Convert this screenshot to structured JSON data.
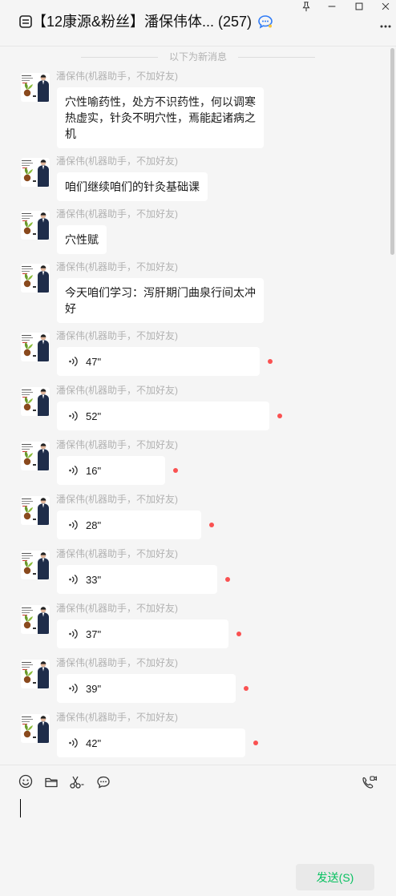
{
  "window": {
    "title": "【12康源&粉丝】潘保伟体...",
    "member_count": "(257)",
    "title_icon": "chat-list-icon",
    "badge_icon": "blue-chat-icon",
    "controls": [
      "pin-icon",
      "minimize-icon",
      "maximize-icon",
      "close-icon"
    ],
    "more_icon": "more-icon"
  },
  "chat": {
    "new_messages_divider": "以下为新消息",
    "messages": [
      {
        "sender": "潘保伟(机器助手，不加好友)",
        "type": "text",
        "lines": [
          "穴性喻药性，处方不识药性，何以调寒",
          "热虚实，针灸不明穴性，焉能起诸病之",
          "机"
        ]
      },
      {
        "sender": "潘保伟(机器助手，不加好友)",
        "type": "text",
        "lines": [
          "咱们继续咱们的针灸基础课"
        ]
      },
      {
        "sender": "潘保伟(机器助手，不加好友)",
        "type": "text",
        "lines": [
          "穴性赋"
        ]
      },
      {
        "sender": "潘保伟(机器助手，不加好友)",
        "type": "text",
        "lines": [
          "今天咱们学习：泻肝期门曲泉行间太冲",
          "好"
        ]
      },
      {
        "sender": "潘保伟(机器助手，不加好友)",
        "type": "voice",
        "duration": "47\"",
        "unplayed": true
      },
      {
        "sender": "潘保伟(机器助手，不加好友)",
        "type": "voice",
        "duration": "52\"",
        "unplayed": true
      },
      {
        "sender": "潘保伟(机器助手，不加好友)",
        "type": "voice",
        "duration": "16\"",
        "unplayed": true
      },
      {
        "sender": "潘保伟(机器助手，不加好友)",
        "type": "voice",
        "duration": "28\"",
        "unplayed": true
      },
      {
        "sender": "潘保伟(机器助手，不加好友)",
        "type": "voice",
        "duration": "33\"",
        "unplayed": true
      },
      {
        "sender": "潘保伟(机器助手，不加好友)",
        "type": "voice",
        "duration": "37\"",
        "unplayed": true
      },
      {
        "sender": "潘保伟(机器助手，不加好友)",
        "type": "voice",
        "duration": "39\"",
        "unplayed": true
      },
      {
        "sender": "潘保伟(机器助手，不加好友)",
        "type": "voice",
        "duration": "42\"",
        "unplayed": true
      }
    ]
  },
  "composer": {
    "toolbar": [
      "emoji-icon",
      "folder-icon",
      "screenshot-icon",
      "chat-history-icon"
    ],
    "call_icon": "video-call-icon",
    "send_label": "发送(S)"
  },
  "colors": {
    "background": "#f5f5f5",
    "bubble": "#ffffff",
    "sender_name": "#b2b2b2",
    "unread_dot": "#fa5151",
    "send_text": "#07c160",
    "send_button_bg": "#e9e9e9",
    "badge": "#2f7bf6"
  }
}
